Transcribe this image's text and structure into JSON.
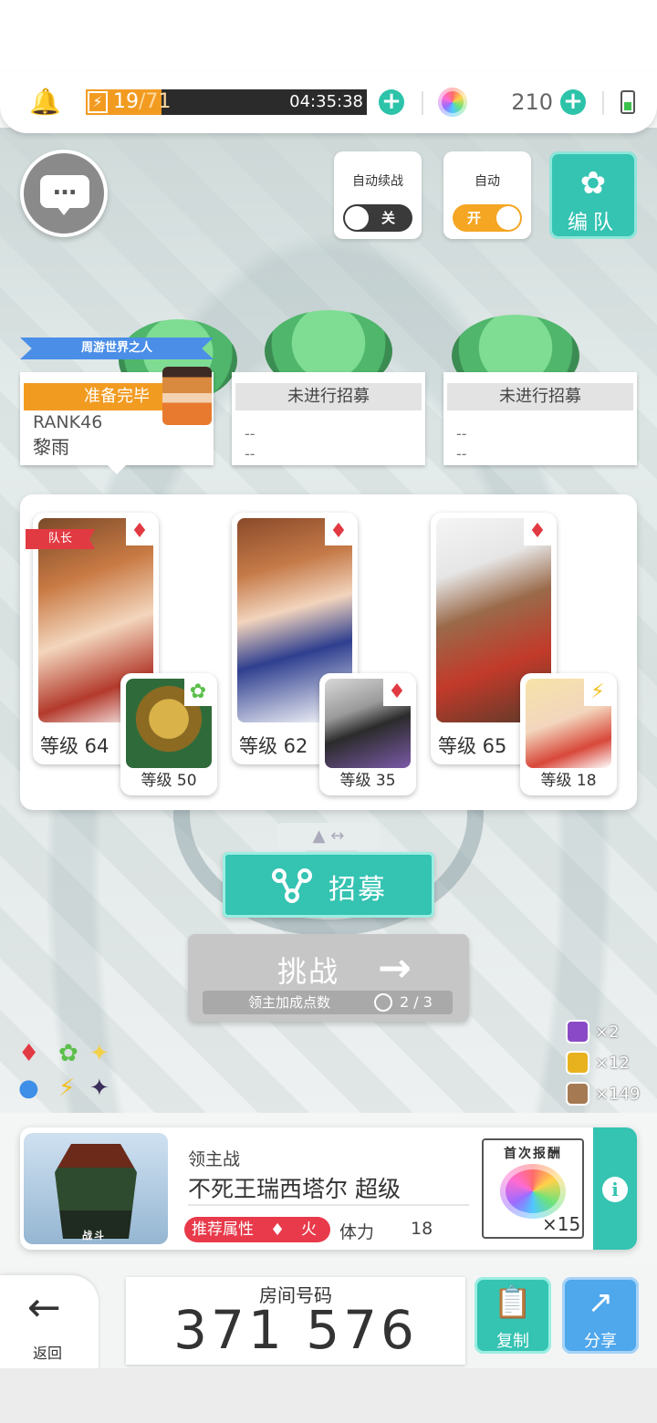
{
  "status": {
    "stamina_current": "19",
    "stamina_max": "/71",
    "stamina_fraction": 0.27,
    "stamina_timer": "04:35:38",
    "gems": "210",
    "icons": {
      "bell": "bell-icon",
      "stamina": "lightning-icon",
      "gem": "rainbow-gem-icon",
      "battery": "battery-icon"
    }
  },
  "controls": {
    "auto_continue_label": "自动续战",
    "auto_continue_state": "关",
    "auto_label": "自动",
    "auto_state": "开",
    "team_label": "编队"
  },
  "party": {
    "title_banner": "周游世界之人",
    "slots": [
      {
        "status": "准备完毕",
        "rank": "RANK46",
        "name": "黎雨"
      },
      {
        "status": "未进行招募",
        "line1": "--",
        "line2": "--"
      },
      {
        "status": "未进行招募",
        "line1": "--",
        "line2": "--"
      }
    ]
  },
  "characters": {
    "leader_tag": "队长",
    "cards": [
      {
        "main_level": "等级 64",
        "sub_level": "等级 50",
        "main_attr": "fire-diamond",
        "sub_attr": "leaf"
      },
      {
        "main_level": "等级 62",
        "sub_level": "等级 35",
        "main_attr": "fire-diamond",
        "sub_attr": "fire-diamond"
      },
      {
        "main_level": "等级 65",
        "sub_level": "等级 18",
        "main_attr": "fire-diamond",
        "sub_attr": "lightning"
      }
    ]
  },
  "actions": {
    "recruit_label": "招募",
    "challenge_label": "挑战",
    "challenge_sub_label": "领主加成点数",
    "challenge_sub_value": "2 / 3"
  },
  "items": [
    {
      "icon": "purple-token-icon",
      "count": "×2"
    },
    {
      "icon": "gold-token-icon",
      "count": "×12"
    },
    {
      "icon": "bronze-token-icon",
      "count": "×149"
    }
  ],
  "boss": {
    "type": "领主战",
    "name": "不死王瑞西塔尔 超级",
    "battle_tag": "战斗",
    "recommend_label": "推荐属性",
    "recommend_value": "火",
    "stamina_label": "体力",
    "stamina_cost": "18",
    "reward_title": "首次报酬",
    "reward_count": "×15"
  },
  "bottom": {
    "back_label": "返回",
    "room_label": "房间号码",
    "room_number": "371 576",
    "copy_label": "复制",
    "share_label": "分享"
  },
  "colors": {
    "accent": "#35c3b2",
    "share": "#4fa7ec",
    "stamina": "#f29b21",
    "ready": "#f29b21",
    "recommend": "#e83a4a"
  }
}
